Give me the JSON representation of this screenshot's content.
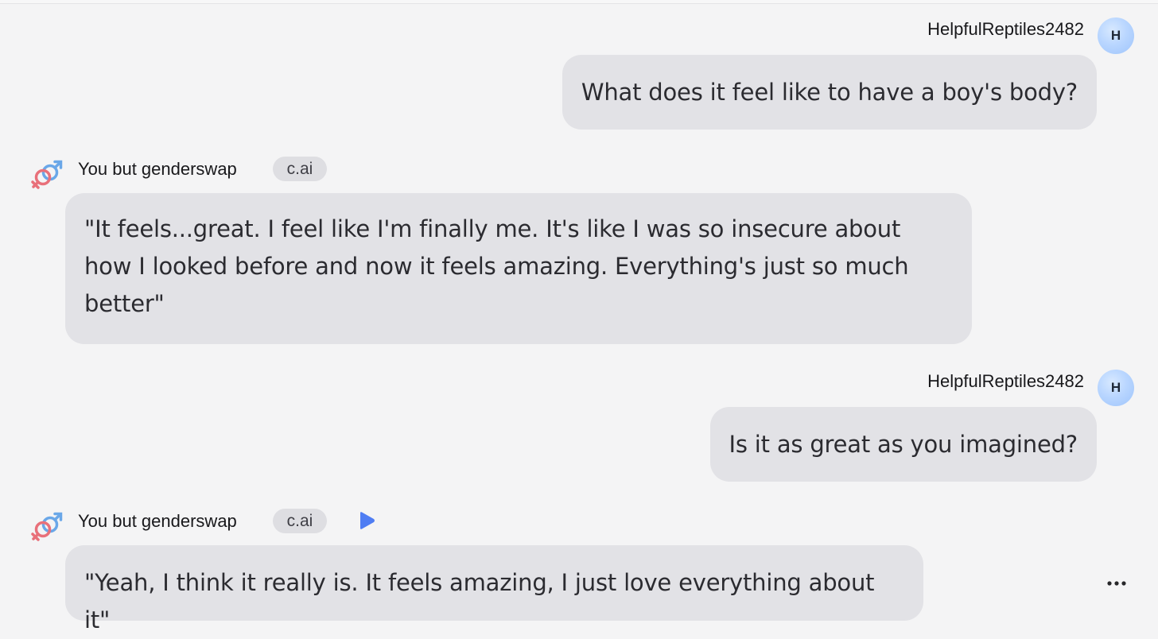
{
  "messages": [
    {
      "role": "user",
      "username": "HelpfulReptiles2482",
      "avatar_initial": "H",
      "text": "What does it feel like to have a boy's body?"
    },
    {
      "role": "bot",
      "character_name": "You but genderswap",
      "badge": "c.ai",
      "avatar_icon": "gender-symbols-icon",
      "text": "\"It feels...great. I feel like I'm finally me. It's like I was so insecure about how I looked before and now it feels amazing. Everything's just so much better\""
    },
    {
      "role": "user",
      "username": "HelpfulReptiles2482",
      "avatar_initial": "H",
      "text": "Is it as great as you imagined?"
    },
    {
      "role": "bot",
      "character_name": "You but genderswap",
      "badge": "c.ai",
      "avatar_icon": "gender-symbols-icon",
      "play_icon": "play-icon",
      "more_icon": "more-options-icon",
      "text": "\"Yeah, I think it really is. It feels amazing, I just love everything about it\""
    }
  ],
  "colors": {
    "background": "#f4f4f5",
    "bubble": "#e2e2e6",
    "accent_play": "#4f7df3",
    "avatar_user": "#b9d6ff",
    "symbol_male": "#6aa7e8",
    "symbol_female": "#e8707a"
  }
}
